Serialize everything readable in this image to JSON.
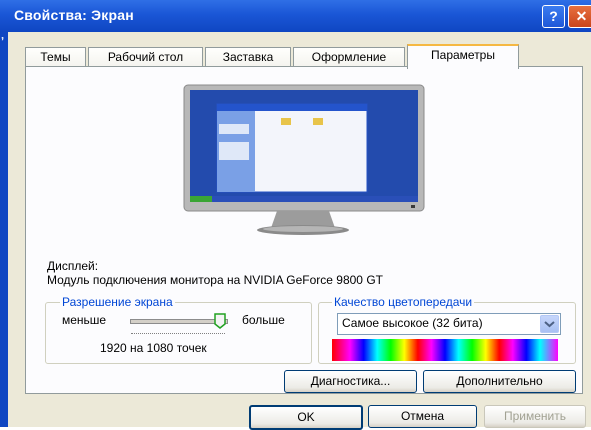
{
  "window": {
    "title": "Свойства: Экран",
    "help_glyph": "?",
    "close_glyph": "✕",
    "left_glyph": "ʼ"
  },
  "tabs": [
    {
      "label": "Темы"
    },
    {
      "label": "Рабочий стол"
    },
    {
      "label": "Заставка"
    },
    {
      "label": "Оформление"
    },
    {
      "label": "Параметры",
      "active": true
    }
  ],
  "display": {
    "label": "Дисплей:",
    "adapter": "Модуль подключения монитора на NVIDIA GeForce 9800 GT"
  },
  "resolution": {
    "group_title": "Разрешение экрана",
    "less": "меньше",
    "more": "больше",
    "value": "1920 на 1080 точек",
    "slider_level": 1.0
  },
  "color_quality": {
    "group_title": "Качество цветопередачи",
    "selected": "Самое высокое (32 бита)"
  },
  "buttons": {
    "troubleshoot": "Диагностика...",
    "advanced": "Дополнительно",
    "ok": "OK",
    "cancel": "Отмена",
    "apply": "Применить"
  },
  "colors": {
    "title_bar": "#1a56d6",
    "group_title": "#0046d5",
    "active_tab_accent": "#f5b843"
  }
}
